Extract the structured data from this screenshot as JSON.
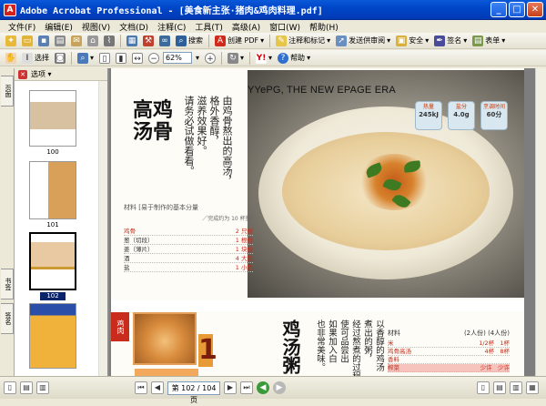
{
  "window": {
    "title": "Adobe Acrobat Professional - [美食新主张·猪肉&鸡肉料理.pdf]",
    "buttons": [
      "minimize",
      "maximize",
      "close"
    ]
  },
  "menu": [
    "文件(F)",
    "编辑(E)",
    "视图(V)",
    "文档(D)",
    "注释(C)",
    "工具(T)",
    "高级(A)",
    "窗口(W)",
    "帮助(H)"
  ],
  "toolbar1": {
    "search_label": "搜索",
    "create_pdf_label": "创建 PDF",
    "review_label": "注释和标记",
    "send_review_label": "发送供审阅",
    "secure_label": "安全",
    "sign_label": "签名",
    "forms_label": "表单"
  },
  "toolbar2": {
    "select_label": "选择",
    "zoom_value": "62%",
    "help_label": "帮助"
  },
  "nav_tabs": [
    "页面",
    "书签",
    "签名"
  ],
  "pages_panel": {
    "options_label": "选项",
    "thumbnails": [
      {
        "label": "100",
        "selected": false
      },
      {
        "label": "101",
        "selected": false
      },
      {
        "label": "102",
        "selected": true
      },
      {
        "label": "",
        "selected": false
      }
    ]
  },
  "document": {
    "watermark": "YYePG, THE NEW EPAGE ERA",
    "dish_title": "高鸡汤骨",
    "intro_lines": [
      "由鸡骨熬出的高汤，",
      "格外香醇，",
      "滋养效果好。",
      "请务必试做看看。"
    ],
    "badges": [
      {
        "top": "热量",
        "value": "245kJ"
      },
      {
        "top": "盐分",
        "value": "4.0g"
      },
      {
        "top": "烹调时间",
        "value": "60分"
      }
    ],
    "ingredients": {
      "heading": "材料 [易于制作的基本分量",
      "sub": "／完成约为 10 杯量]",
      "items": [
        {
          "name": "鸡骨",
          "amount": "2 只份"
        },
        {
          "name": "葱（切段）",
          "amount": "1 根份"
        },
        {
          "name": "姜（薄片）",
          "amount": "1 块份"
        },
        {
          "name": "酒",
          "amount": "4 大匙"
        },
        {
          "name": "盐",
          "amount": "1 小匙"
        }
      ]
    },
    "side_tag": "鸡肉",
    "big_number": "1",
    "bottom_title": "鸡汤粥",
    "bottom_lines": [
      "以香醇的鸡汤",
      "煮出的粥，",
      "经过熬煮的过程",
      "使可品尝出",
      "如果加入白",
      "也非常美味。"
    ],
    "recipe2": {
      "header_left": "材料",
      "header_right": "(2人份) (4人份)",
      "rows": [
        {
          "name": "米",
          "a": "1/2杯",
          "b": "1杯"
        },
        {
          "name": "鸡骨高汤",
          "a": "4杯",
          "b": "8杯"
        },
        {
          "name": "香料",
          "a": "",
          "b": ""
        },
        {
          "name": "榨菜",
          "a": "少许",
          "b": "少许"
        }
      ]
    }
  },
  "statusbar": {
    "page_indicator": "第 102 / 104 页"
  }
}
